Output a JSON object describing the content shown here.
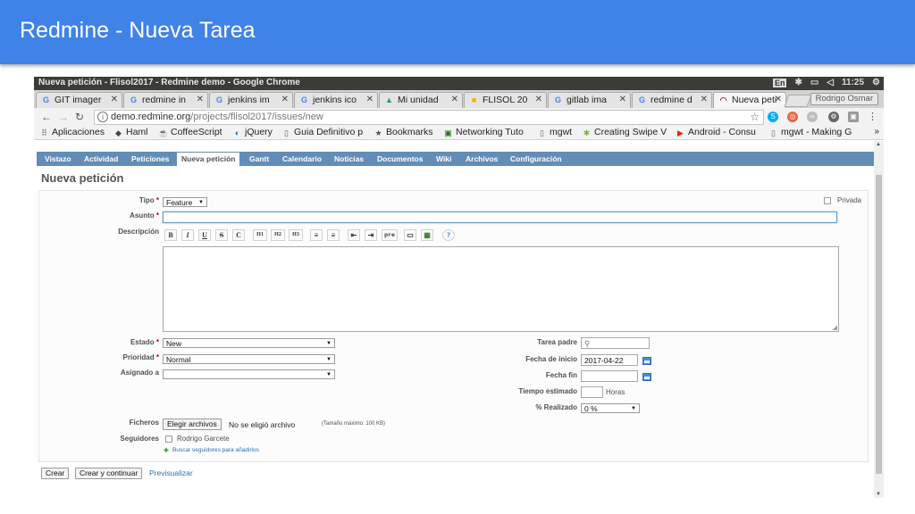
{
  "slide": {
    "title": "Redmine - Nueva Tarea"
  },
  "window": {
    "title": "Nueva petición - Flisol2017 - Redmine demo - Google Chrome",
    "lang": "En",
    "clock": "11:25"
  },
  "tabs": [
    {
      "label": "GIT imager",
      "icon": "G"
    },
    {
      "label": "redmine in",
      "icon": "G"
    },
    {
      "label": "jenkins im",
      "icon": "G"
    },
    {
      "label": "jenkins ico",
      "icon": "G"
    },
    {
      "label": "Mi unidad",
      "icon": "▲"
    },
    {
      "label": "FLISOL 20",
      "icon": "■"
    },
    {
      "label": "gitlab ima",
      "icon": "G"
    },
    {
      "label": "redmine d",
      "icon": "G"
    },
    {
      "label": "Nueva peti",
      "icon": "◠"
    }
  ],
  "user_badge": "Rodrigo Osmar",
  "address": {
    "domain": "demo.redmine.org",
    "path": "/projects/flisol2017/issues/new"
  },
  "bookmarks": [
    {
      "label": "Aplicaciones",
      "icon": "⠿"
    },
    {
      "label": "Haml",
      "icon": "◆"
    },
    {
      "label": "CoffeeScript",
      "icon": "☕"
    },
    {
      "label": "jQuery",
      "icon": "◐"
    },
    {
      "label": "Guia Definitivo p",
      "icon": "▯"
    },
    {
      "label": "Bookmarks",
      "icon": "★"
    },
    {
      "label": "Networking Tuto",
      "icon": "▣"
    },
    {
      "label": "mgwt",
      "icon": "▯"
    },
    {
      "label": "Creating Swipe V",
      "icon": "✱"
    },
    {
      "label": "Android - Consu",
      "icon": "▶"
    },
    {
      "label": "mgwt - Making G",
      "icon": "▯"
    }
  ],
  "bookmarks_more": "»",
  "redmine": {
    "nav": [
      "Vistazo",
      "Actividad",
      "Peticiones",
      "Nueva petición",
      "Gantt",
      "Calendario",
      "Noticias",
      "Documentos",
      "Wiki",
      "Archivos",
      "Configuración"
    ],
    "heading": "Nueva petición",
    "form": {
      "tipo_label": "Tipo",
      "tipo_value": "Feature",
      "privada_label": "Privada",
      "asunto_label": "Asunto",
      "descripcion_label": "Descripción",
      "toolbar": [
        "B",
        "I",
        "U",
        "S",
        "C",
        "H1",
        "H2",
        "H3",
        "≡",
        "≡",
        "⇤",
        "⇥",
        "pre",
        "▭",
        "▦",
        "?"
      ],
      "estado_label": "Estado",
      "estado_value": "New",
      "prioridad_label": "Prioridad",
      "prioridad_value": "Normal",
      "asignado_label": "Asignado a",
      "asignado_value": "",
      "tarea_padre_label": "Tarea padre",
      "fecha_inicio_label": "Fecha de inicio",
      "fecha_inicio_value": "2017-04-22",
      "fecha_fin_label": "Fecha fin",
      "tiempo_label": "Tiempo estimado",
      "horas_label": "Horas",
      "realizado_label": "% Realizado",
      "realizado_value": "0 %",
      "ficheros_label": "Ficheros",
      "elegir_label": "Elegir archivos",
      "no_file_text": "No se eligió archivo",
      "max_size_text": "(Tamaño máximo: 100 KB)",
      "seguidores_label": "Seguidores",
      "seguidor_name": "Rodrigo Garcete",
      "buscar_link": "Buscar seguidores para añadirlos"
    },
    "buttons": {
      "crear": "Crear",
      "crear_continuar": "Crear y continuar",
      "previsualizar": "Previsualizar"
    }
  },
  "colors": {
    "slide_header": "#3f82e8",
    "redmine_nav": "#628db6",
    "required": "#bb0000",
    "link": "#2a6fb5"
  }
}
